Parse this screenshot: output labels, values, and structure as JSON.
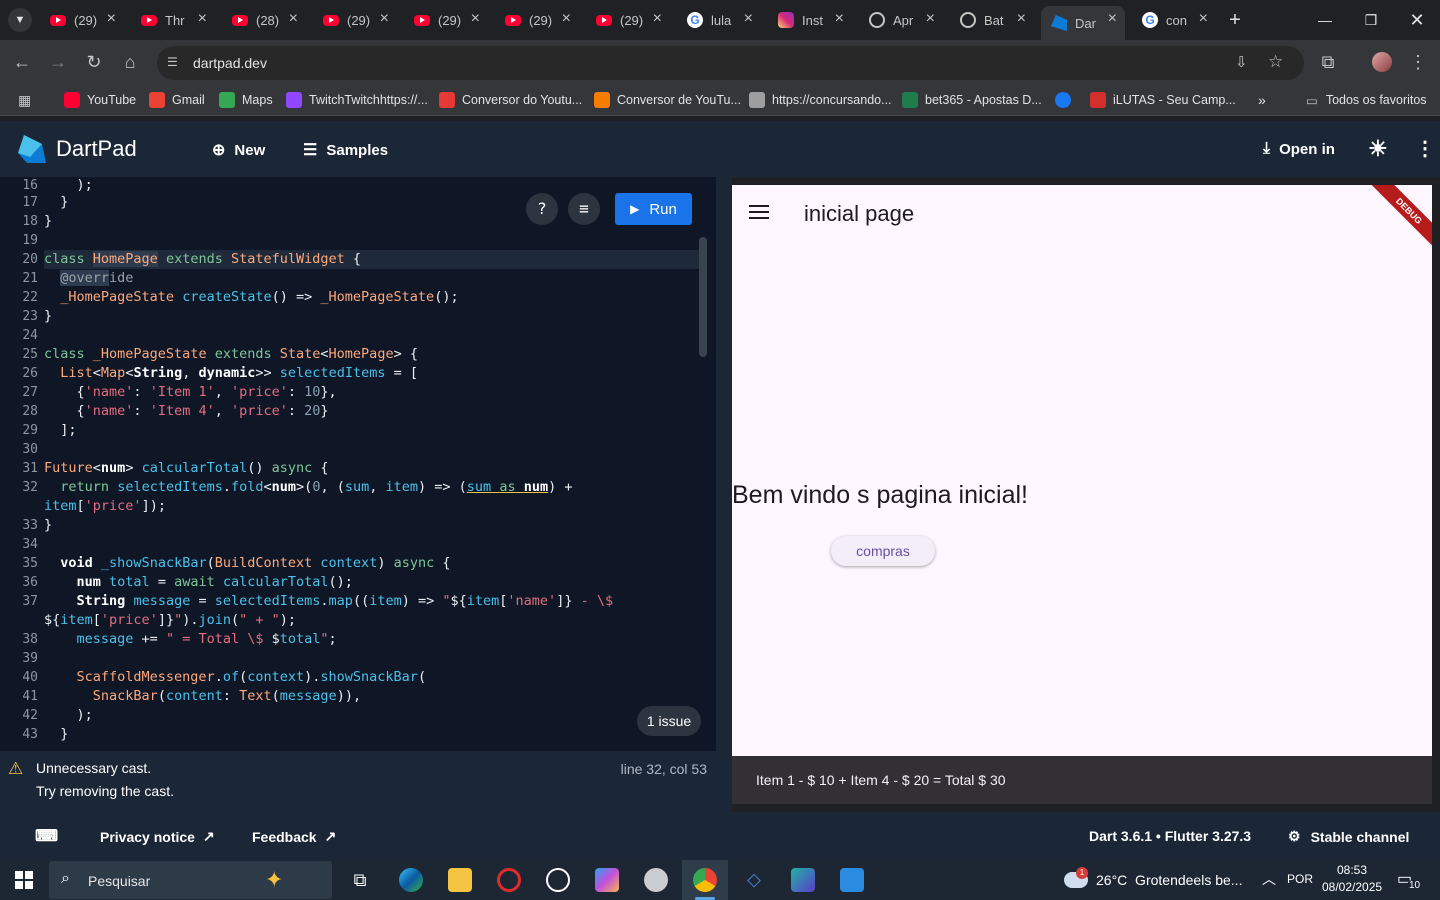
{
  "browser": {
    "tabs": [
      {
        "label": "(29)",
        "icon": "youtube-icon"
      },
      {
        "label": "Thr",
        "icon": "youtube-icon"
      },
      {
        "label": "(28)",
        "icon": "youtube-icon"
      },
      {
        "label": "(29)",
        "icon": "youtube-icon"
      },
      {
        "label": "(29)",
        "icon": "youtube-icon"
      },
      {
        "label": "(29)",
        "icon": "youtube-icon"
      },
      {
        "label": "(29)",
        "icon": "youtube-icon"
      },
      {
        "label": "lula",
        "icon": "google-icon"
      },
      {
        "label": "Inst",
        "icon": "instagram-icon"
      },
      {
        "label": "Apr",
        "icon": "openai-icon"
      },
      {
        "label": "Bat",
        "icon": "openai-icon"
      },
      {
        "label": "Dar",
        "icon": "dart-icon",
        "active": true
      },
      {
        "label": "con",
        "icon": "google-icon"
      }
    ],
    "url": "dartpad.dev",
    "bookmarks": [
      {
        "label": "YouTube",
        "color": "#ff0033"
      },
      {
        "label": "Gmail",
        "color": "#ea4335"
      },
      {
        "label": "Maps",
        "color": "#34a853"
      },
      {
        "label": "TwitchTwitchhttps://...",
        "color": "#9146ff"
      },
      {
        "label": "Conversor do Youtu...",
        "color": "#e53935"
      },
      {
        "label": "Conversor de YouTu...",
        "color": "#f57c00"
      },
      {
        "label": "https://concursando...",
        "color": "#9e9e9e"
      },
      {
        "label": "bet365 - Apostas D...",
        "color": "#1e7d4a"
      },
      {
        "label": "",
        "color": "#1877f2"
      },
      {
        "label": "iLUTAS - Seu Camp...",
        "color": "#d32f2f"
      }
    ],
    "more_bookmarks": "»",
    "all_bookmarks": "Todos os favoritos"
  },
  "dartpad": {
    "title": "DartPad",
    "new_label": "New",
    "samples_label": "Samples",
    "open_in_label": "Open in",
    "run_label": "Run",
    "issues_label": "1 issue",
    "problem": {
      "message": "Unnecessary cast.",
      "fix": "Try removing the cast.",
      "location": "line 32, col 53"
    },
    "line_numbers": [
      "16",
      "17",
      "18",
      "19",
      "20",
      "21",
      "22",
      "23",
      "24",
      "25",
      "26",
      "27",
      "28",
      "29",
      "30",
      "31",
      "32",
      "",
      "33",
      "34",
      "35",
      "36",
      "37",
      "",
      "38",
      "39",
      "40",
      "41",
      "42",
      "43"
    ]
  },
  "preview": {
    "appbar_title": "inicial page",
    "debug_banner": "DEBUG",
    "welcome_text": "Bem vindo s pagina inicial!",
    "button_label": "compras",
    "snackbar_text": "Item 1 - $ 10 + Item 4 - $ 20 = Total $ 30"
  },
  "footer": {
    "privacy": "Privacy notice",
    "feedback": "Feedback",
    "version": "Dart 3.6.1 • Flutter 3.27.3",
    "channel": "Stable channel"
  },
  "taskbar": {
    "search_placeholder": "Pesquisar",
    "weather": "26°C  Grotendeels be...",
    "language": "POR",
    "time": "08:53",
    "date": "08/02/2025",
    "notifications": "10",
    "weather_badge": "1"
  }
}
